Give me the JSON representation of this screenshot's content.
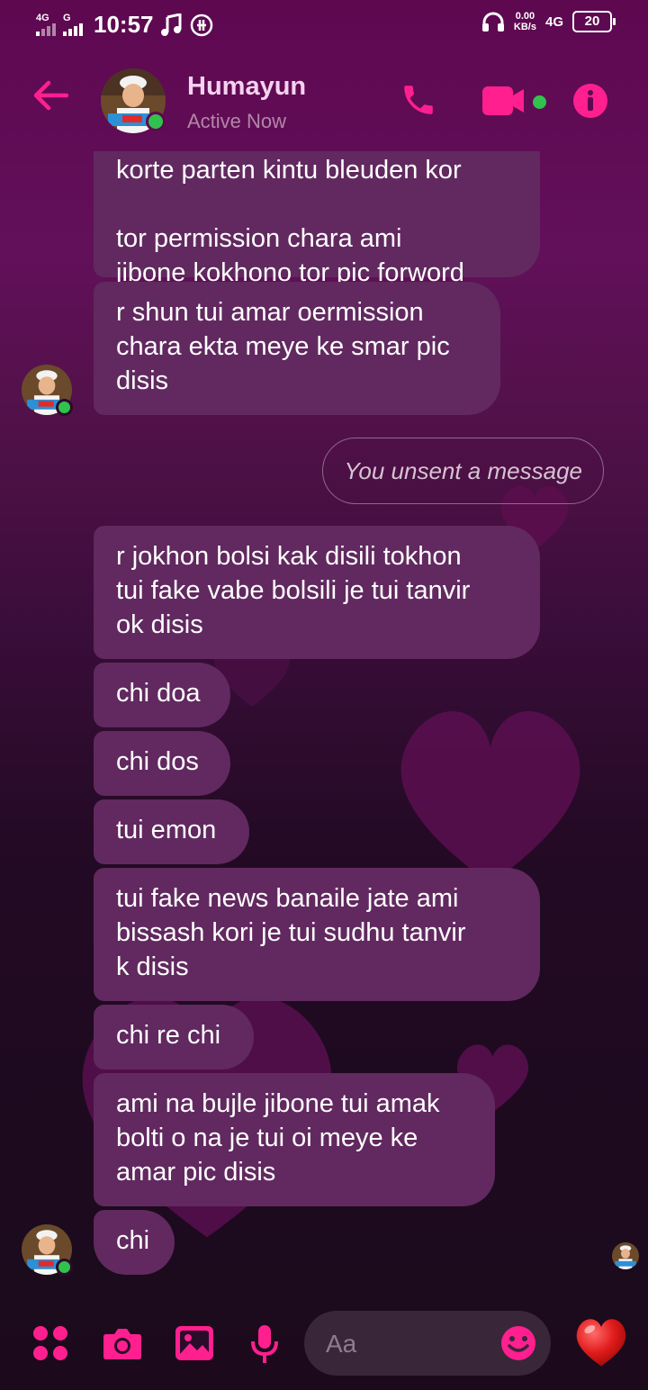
{
  "status_bar": {
    "network_1": "4G",
    "network_2": "G",
    "time": "10:57",
    "speed_value": "0.00",
    "speed_unit": "KB/s",
    "network_3": "4G",
    "battery": "20"
  },
  "header": {
    "contact_name": "Humayun",
    "presence": "Active Now",
    "icons": [
      "back-arrow-icon",
      "phone-icon",
      "video-camera-icon",
      "info-icon"
    ]
  },
  "conversation": {
    "incoming_group_1": [
      "korte parten kintu bleuden kor",
      "tor permission chara ami\njibone kokhono tor pic forword\nkorbo na",
      "r shun tui amar oermission\nchara ekta meye ke smar pic\ndisis"
    ],
    "unsent_notice": "You unsent a message",
    "incoming_group_2": [
      "r jokhon bolsi kak disili tokhon\ntui fake vabe bolsili je tui tanvir\nok disis",
      "chi doa",
      "chi dos",
      "tui emon",
      "tui fake news banaile jate ami\nbissash kori je tui sudhu tanvir\nk disis",
      "chi re chi",
      "ami na bujle jibone tui amak\nbolti o na je tui oi meye ke\namar pic disis",
      "chi"
    ]
  },
  "composer": {
    "placeholder": "Aa",
    "icons": [
      "menu-dots-icon",
      "camera-icon",
      "gallery-icon",
      "microphone-icon",
      "emoji-icon",
      "heart-like-icon"
    ]
  },
  "colors": {
    "accent": "#ff1f8f",
    "incoming_bubble": "#61295f",
    "online": "#31c24d"
  }
}
